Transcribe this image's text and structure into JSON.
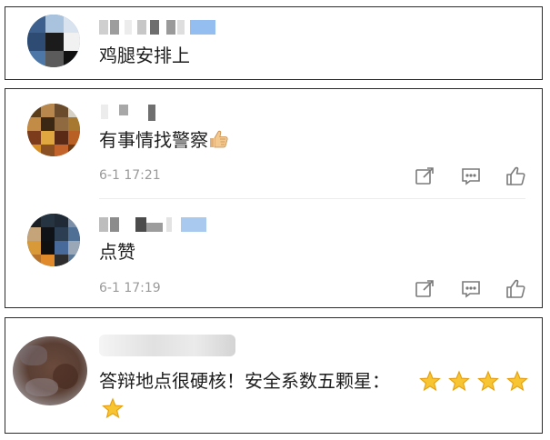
{
  "comments": [
    {
      "text": "鸡腿安排上"
    },
    {
      "text": "有事情找警察",
      "time": "6-1 17:21"
    },
    {
      "text": "点赞",
      "time": "6-1 17:19"
    },
    {
      "text": "答辩地点很硬核！安全系数五颗星："
    }
  ],
  "icons": {
    "share": "share-icon",
    "comment": "comment-icon",
    "like": "like-icon",
    "thumbs_up_emoji": "thumbs-up-icon",
    "star_emoji": "star-icon"
  },
  "star_rating": {
    "count": 5
  },
  "colors": {
    "text": "#1d1d1d",
    "meta": "#9a9a9a",
    "icon": "#7a7a7a",
    "border": "#2b2b2b"
  }
}
